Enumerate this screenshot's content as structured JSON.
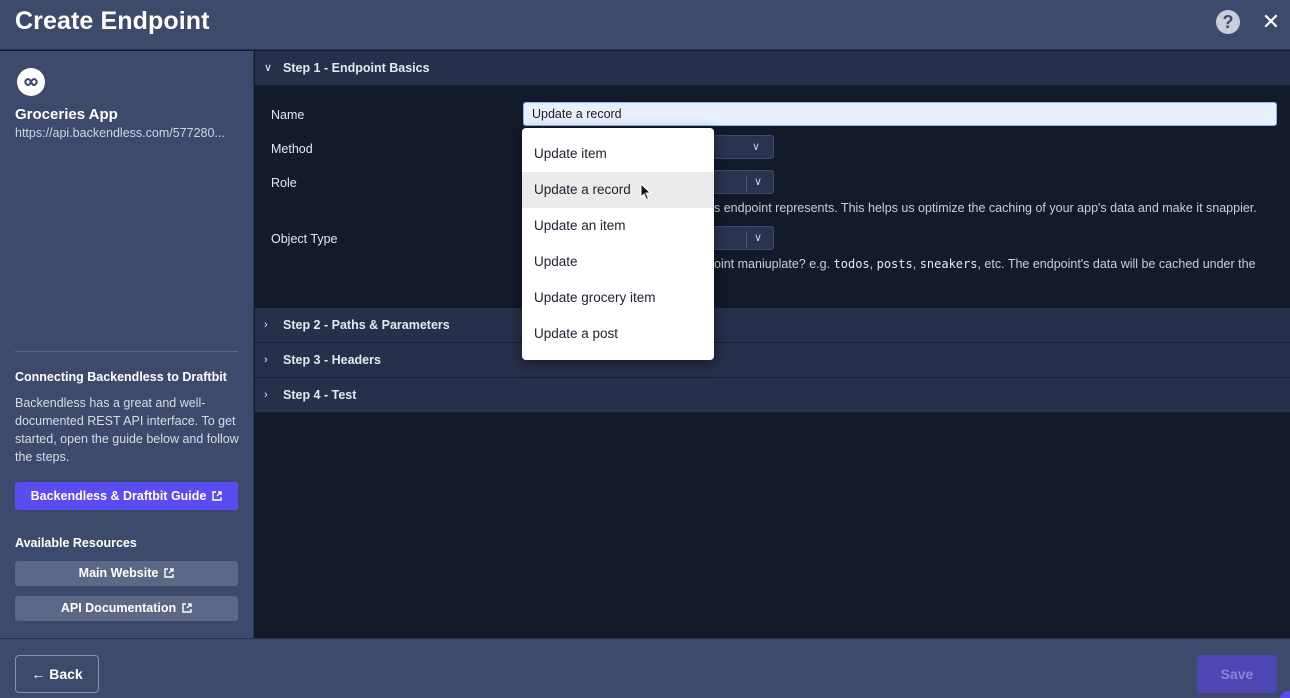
{
  "header": {
    "title": "Create Endpoint",
    "help_label": "?",
    "close_label": "✕"
  },
  "sidebar": {
    "app_name": "Groceries App",
    "app_url": "https://api.backendless.com/577280...",
    "guide_heading": "Connecting Backendless to Draftbit",
    "guide_text": "Backendless has a great and well-documented REST API interface. To get started, open the guide below and follow the steps.",
    "guide_button": "Backendless & Draftbit Guide",
    "resources_heading": "Available Resources",
    "resources": [
      "Main Website",
      "API Documentation"
    ]
  },
  "steps": [
    {
      "label": "Step 1 - Endpoint Basics",
      "expanded": true
    },
    {
      "label": "Step 2 - Paths & Parameters",
      "expanded": false
    },
    {
      "label": "Step 3 - Headers",
      "expanded": false
    },
    {
      "label": "Step 4 - Test",
      "expanded": false
    }
  ],
  "form": {
    "name_label": "Name",
    "name_value": "Update a record",
    "method_label": "Method",
    "role_label": "Role",
    "role_help": "s endpoint represents. This helps us optimize the caching of your app's data and make it snappier.",
    "object_type_label": "Object Type",
    "object_help_prefix": "oint maniuplate? e.g. ",
    "object_help_code1": "todos",
    "object_help_sep1": ", ",
    "object_help_code2": "posts",
    "object_help_sep2": ", ",
    "object_help_code3": "sneakers",
    "object_help_suffix": ", etc. The endpoint's data will be cached under the"
  },
  "dropdown": {
    "items": [
      "Update item",
      "Update a record",
      "Update an item",
      "Update",
      "Update grocery item",
      "Update a post"
    ],
    "hovered": "Update a record"
  },
  "footer": {
    "back_label": "Back",
    "save_label": "Save"
  },
  "colors": {
    "header_bg": "#3d4a6b",
    "main_bg": "#131a2a",
    "accent": "#5a4cf0",
    "save_disabled": "#4d46b3"
  }
}
